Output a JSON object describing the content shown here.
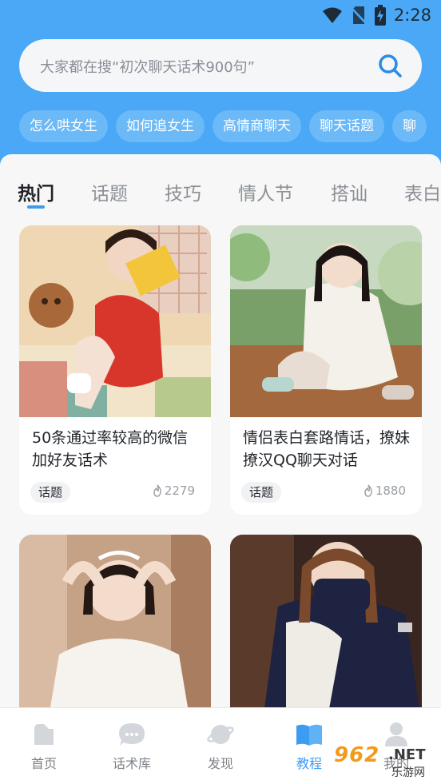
{
  "status_bar": {
    "time": "2:28"
  },
  "search": {
    "placeholder": "大家都在搜“初次聊天话术900句”",
    "icon": "search-icon"
  },
  "chips": [
    "怎么哄女生",
    "如何追女生",
    "高情商聊天",
    "聊天话题",
    "聊"
  ],
  "tabs": [
    "热门",
    "话题",
    "技巧",
    "情人节",
    "搭讪",
    "表白"
  ],
  "active_tab": "热门",
  "cards": [
    {
      "title": "50条通过率较高的微信加好友话术",
      "tag": "话题",
      "views": "2279"
    },
    {
      "title": "情侣表白套路情话，撩妹撩汉QQ聊天对话",
      "tag": "话题",
      "views": "1880"
    },
    {
      "title": "",
      "tag": "",
      "views": ""
    },
    {
      "title": "",
      "tag": "",
      "views": ""
    }
  ],
  "bottom_nav": [
    {
      "label": "首页",
      "icon": "home-icon",
      "active": false
    },
    {
      "label": "话术库",
      "icon": "chat-library-icon",
      "active": false
    },
    {
      "label": "发现",
      "icon": "planet-icon",
      "active": false
    },
    {
      "label": "教程",
      "icon": "book-icon",
      "active": true
    },
    {
      "label": "我的",
      "icon": "user-icon",
      "active": false
    }
  ],
  "watermark": {
    "number": "962",
    "suffix": ".NET",
    "caption": "乐游网"
  },
  "colors": {
    "primary": "#4aa8f6",
    "accent": "#3b9cf1",
    "chip": "#6cb9f7",
    "watermark": "#f29a1c"
  }
}
